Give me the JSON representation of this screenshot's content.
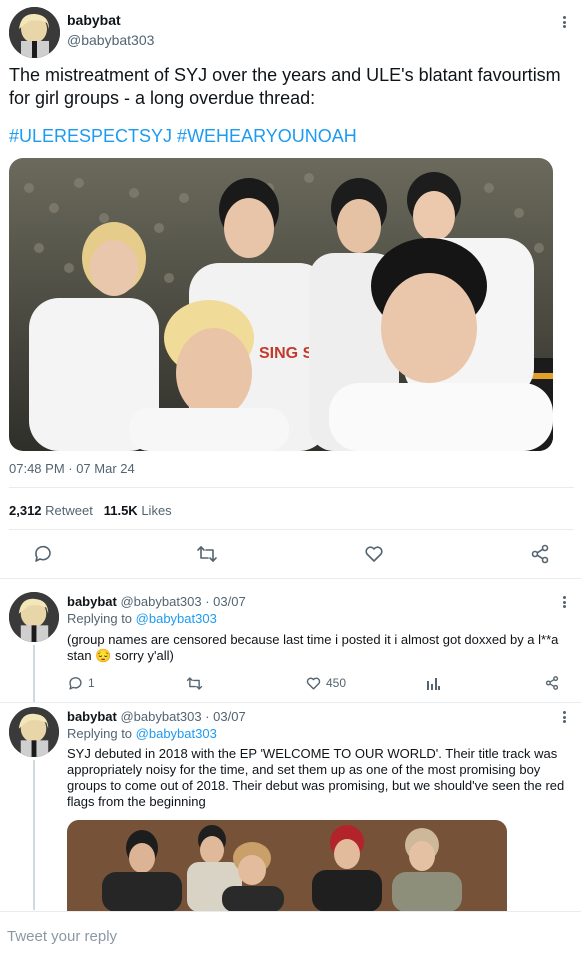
{
  "main_tweet": {
    "display_name": "babybat",
    "handle": "@babybat303",
    "text": "The mistreatment of SYJ over the years and ULE's blatant favourtism for girl groups - a long overdue thread:",
    "hashtags": "#ULERESPECTSYJ #WEHEARYOUNOAH",
    "timestamp": "07:48 PM · 07 Mar 24",
    "retweet_count": "2,312",
    "retweet_label": "Retweet",
    "like_count": "11.5K",
    "like_label": "Likes",
    "photo_shirt_text": "SING SING SING"
  },
  "replies": [
    {
      "display_name": "babybat",
      "handle_date": "@babybat303 · 03/07",
      "replying_prefix": "Replying to",
      "replying_handle": "@babybat303",
      "text": "(group names are censored because last time i posted it i almost got doxxed by a l**a stan 😔 sorry y'all)",
      "reply_count": "1",
      "like_count": "450"
    },
    {
      "display_name": "babybat",
      "handle_date": "@babybat303 · 03/07",
      "replying_prefix": "Replying to",
      "replying_handle": "@babybat303",
      "text": "SYJ debuted in 2018 with the EP 'WELCOME TO OUR WORLD'. Their title track was appropriately noisy for the time, and set them up as one of the most promising boy groups to come out of 2018. Their debut was promising, but we should've seen the red flags from the beginning"
    }
  ],
  "compose": {
    "placeholder": "Tweet your reply"
  },
  "colors": {
    "accent": "#1d9bf0",
    "muted": "#536471",
    "divider": "#e6ecf0"
  },
  "icons": [
    "avatar",
    "more-icon",
    "reply-icon",
    "retweet-icon",
    "like-icon",
    "share-icon",
    "analytics-icon"
  ]
}
